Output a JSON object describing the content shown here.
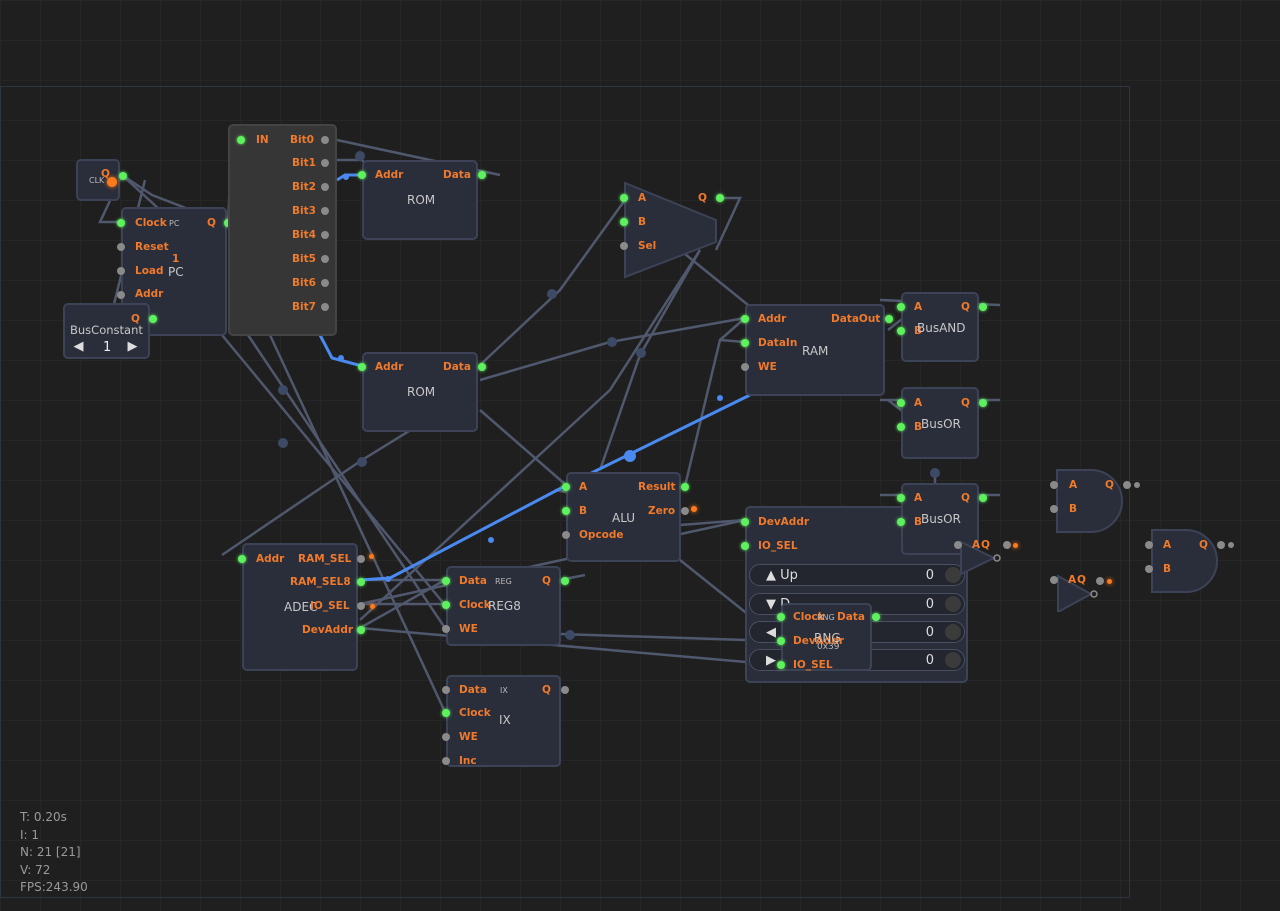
{
  "nodes": {
    "clk": {
      "label": "CLK",
      "q": "Q"
    },
    "pc": {
      "title": "PC",
      "tag": "PC",
      "value": "1",
      "pins": {
        "clock": "Clock",
        "reset": "Reset",
        "load": "Load",
        "addr": "Addr",
        "q": "Q"
      }
    },
    "busconst": {
      "title": "BusConstant",
      "value": "1",
      "left_arrow": "◀",
      "right_arrow": "▶",
      "q": "Q"
    },
    "splitter": {
      "in": "IN",
      "bits": [
        "Bit0",
        "Bit1",
        "Bit2",
        "Bit3",
        "Bit4",
        "Bit5",
        "Bit6",
        "Bit7"
      ]
    },
    "rom1": {
      "title": "ROM",
      "addr": "Addr",
      "data": "Data"
    },
    "rom2": {
      "title": "ROM",
      "addr": "Addr",
      "data": "Data"
    },
    "mux": {
      "a": "A",
      "b": "B",
      "sel": "Sel",
      "q": "Q"
    },
    "ram": {
      "title": "RAM",
      "addr": "Addr",
      "datain": "DataIn",
      "we": "WE",
      "dataout": "DataOut"
    },
    "alu": {
      "title": "ALU",
      "a": "A",
      "b": "B",
      "opcode": "Opcode",
      "result": "Result",
      "zero": "Zero"
    },
    "adec": {
      "title": "ADEC",
      "addr": "Addr",
      "ram_sel": "RAM_SEL",
      "ram_sel8": "RAM_SEL8",
      "io_sel": "IO_SEL",
      "devaddr": "DevAddr"
    },
    "reg8": {
      "title": "REG8",
      "tag": "REG",
      "data": "Data",
      "clock": "Clock",
      "we": "WE",
      "q": "Q"
    },
    "ix": {
      "title": "IX",
      "tag": "IX",
      "data": "Data",
      "clock": "Clock",
      "we": "WE",
      "inc": "Inc",
      "q": "Q"
    },
    "busand": {
      "title": "BusAND",
      "a": "A",
      "b": "B",
      "q": "Q"
    },
    "busor1": {
      "title": "BusOR",
      "a": "A",
      "b": "B",
      "q": "Q"
    },
    "busor2": {
      "title": "BusOR",
      "a": "A",
      "b": "B",
      "q": "Q"
    },
    "io": {
      "devaddr": "DevAddr",
      "io_sel": "IO_SEL",
      "rows": [
        {
          "label": "▲ Up",
          "value": "0"
        },
        {
          "label": "▼ D",
          "value": "0"
        },
        {
          "label": "◀",
          "value": "0"
        },
        {
          "label": "▶",
          "value": "0"
        }
      ]
    },
    "rng": {
      "title": "RNG",
      "tag": "RNG",
      "seed": "0x39",
      "clock": "Clock",
      "devaddr": "DevAddr",
      "io_sel": "IO_SEL",
      "data": "Data"
    },
    "not1": {
      "a": "A",
      "q": "Q"
    },
    "not2": {
      "a": "A",
      "q": "Q"
    },
    "and1": {
      "a": "A",
      "b": "B",
      "q": "Q"
    },
    "and2": {
      "a": "A",
      "b": "B",
      "q": "Q"
    }
  },
  "stats": {
    "t": "T: 0.20s",
    "i": "I: 1",
    "n": "N: 21 [21]",
    "v": "V: 72",
    "fps": "FPS:243.90"
  },
  "colors": {
    "background": "#1f1f1f",
    "node": "#2a2d3a",
    "pin_label": "#f07a2a",
    "pin_active": "#5ef05e",
    "wire_active": "#4a8af0"
  }
}
